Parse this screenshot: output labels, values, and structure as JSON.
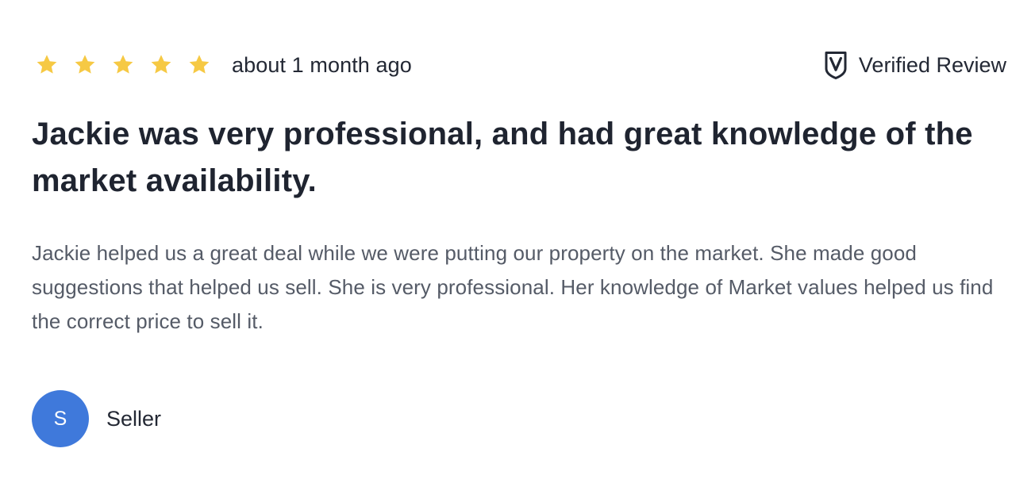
{
  "review": {
    "rating": 5,
    "rating_max": 5,
    "time_ago": "about 1 month ago",
    "verified_label": "Verified Review",
    "title": "Jackie was very professional, and had great knowledge of the market availability.",
    "body": "Jackie helped us a great deal while we were putting our property on the market. She made good suggestions that helped us sell. She is very professional. Her knowledge of Market values helped us find the correct price to sell it.",
    "reviewer": {
      "initial": "S",
      "role": "Seller"
    }
  },
  "icons": {
    "star": "star-icon",
    "verified": "shield-check-icon"
  },
  "colors": {
    "star": "#F6C944",
    "avatar": "#3F79DB",
    "text_primary": "#1F2430",
    "text_secondary": "#555B67"
  }
}
